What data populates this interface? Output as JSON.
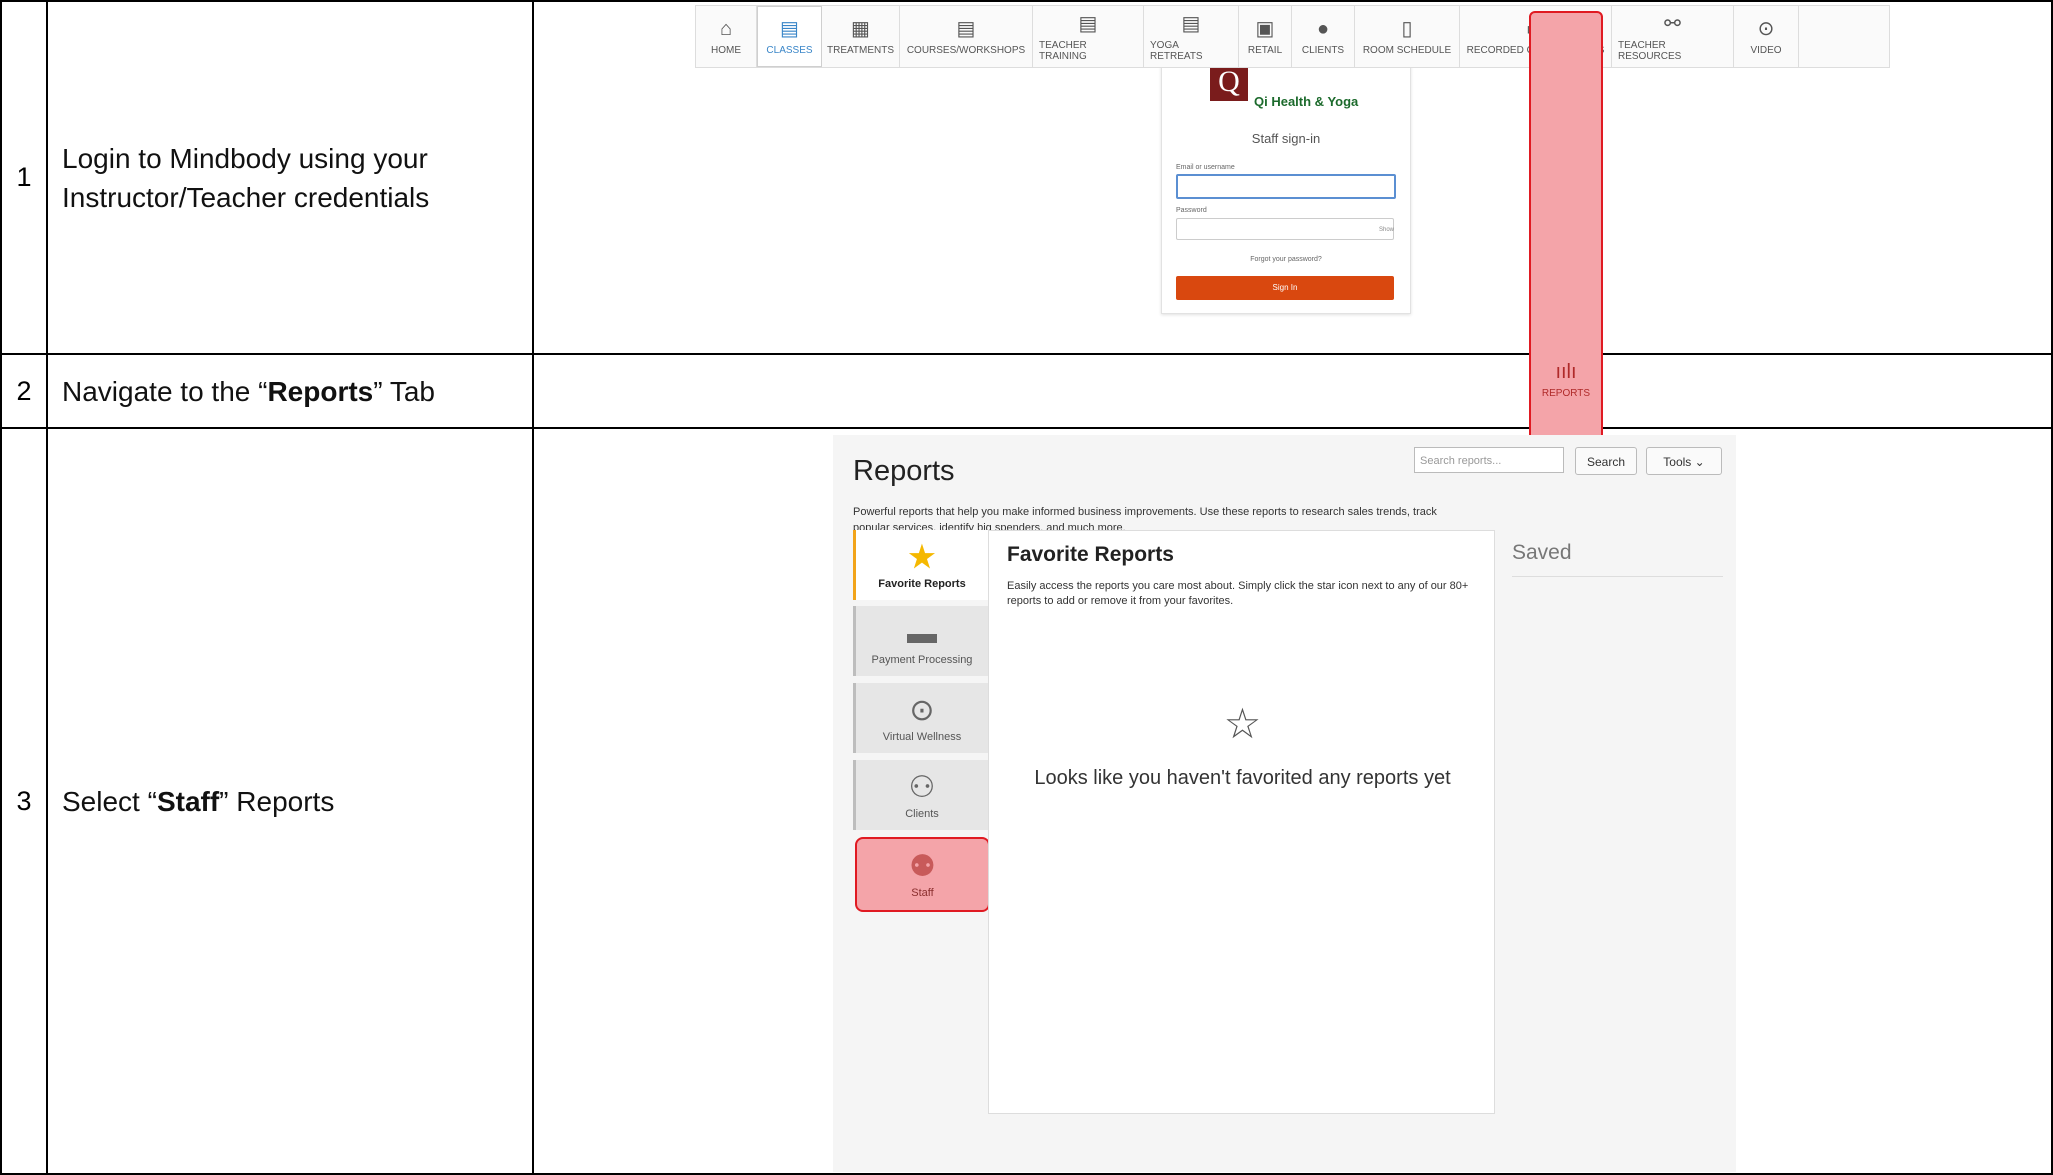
{
  "steps": [
    {
      "num": "1",
      "text": "Login to Mindbody using your Instructor/Teacher credentials"
    },
    {
      "num": "2",
      "text_before": "Navigate to the “",
      "text_bold": "Reports",
      "text_after": "” Tab"
    },
    {
      "num": "3",
      "text_before": "Select “",
      "text_bold": "Staff",
      "text_after": "” Reports"
    }
  ],
  "login": {
    "logo_letter": "Q",
    "brand": "Qi Health & Yoga",
    "title": "Staff sign-in",
    "email_label": "Email or username",
    "password_label": "Password",
    "show": "Show",
    "forgot": "Forgot your password?",
    "sign_in": "Sign In",
    "brand_color": "#1c6a2c",
    "button_color": "#d9480f"
  },
  "nav": {
    "items": [
      {
        "label": "HOME",
        "icon": "home-icon",
        "glyph": "⌂"
      },
      {
        "label": "CLASSES",
        "icon": "calendar-icon",
        "glyph": "▤"
      },
      {
        "label": "TREATMENTS",
        "icon": "calendar-icon",
        "glyph": "▦"
      },
      {
        "label": "COURSES/WORKSHOPS",
        "icon": "calendar-icon",
        "glyph": "▤"
      },
      {
        "label": "TEACHER TRAINING",
        "icon": "calendar-icon",
        "glyph": "▤"
      },
      {
        "label": "YOGA RETREATS",
        "icon": "calendar-icon",
        "glyph": "▤"
      },
      {
        "label": "RETAIL",
        "icon": "register-icon",
        "glyph": "▣"
      },
      {
        "label": "CLIENTS",
        "icon": "user-icon",
        "glyph": "●"
      },
      {
        "label": "ROOM SCHEDULE",
        "icon": "door-icon",
        "glyph": "▯"
      },
      {
        "label": "RECORDED ONLINE VIDEOS",
        "icon": "screen-icon",
        "glyph": "▭"
      },
      {
        "label": "TEACHER RESOURCES",
        "icon": "link-icon",
        "glyph": "⚯"
      },
      {
        "label": "REPORTS",
        "icon": "bar-chart-icon",
        "glyph": "ıılı"
      },
      {
        "label": "VIDEO",
        "icon": "play-icon",
        "glyph": "⊙"
      }
    ],
    "active": "CLASSES",
    "highlight": "REPORTS",
    "active_color": "#3a86c8",
    "highlight_color": "#e01a22"
  },
  "reports": {
    "title": "Reports",
    "search_placeholder": "Search reports...",
    "search_button": "Search",
    "tools_button": "Tools ⌄",
    "description": "Powerful reports that help you make informed business improvements. Use these reports to research sales trends, track popular services, identify big spenders, and much more.",
    "sidebar": [
      {
        "label": "Favorite Reports",
        "icon": "star-icon",
        "glyph": "★"
      },
      {
        "label": "Payment Processing",
        "icon": "credit-card-icon",
        "glyph": "▬"
      },
      {
        "label": "Virtual Wellness",
        "icon": "play-circle-icon",
        "glyph": "⊙"
      },
      {
        "label": "Clients",
        "icon": "clients-icon",
        "glyph": "⚇"
      },
      {
        "label": "Staff",
        "icon": "staff-icon",
        "glyph": "⚉"
      }
    ],
    "favorites_heading": "Favorite Reports",
    "favorites_text": "Easily access the reports you care most about. Simply click the star icon next to any of our 80+ reports to add or remove it from your favorites.",
    "empty_glyph": "☆",
    "empty_text": "Looks like you haven't favorited any reports yet",
    "saved": "Saved"
  }
}
